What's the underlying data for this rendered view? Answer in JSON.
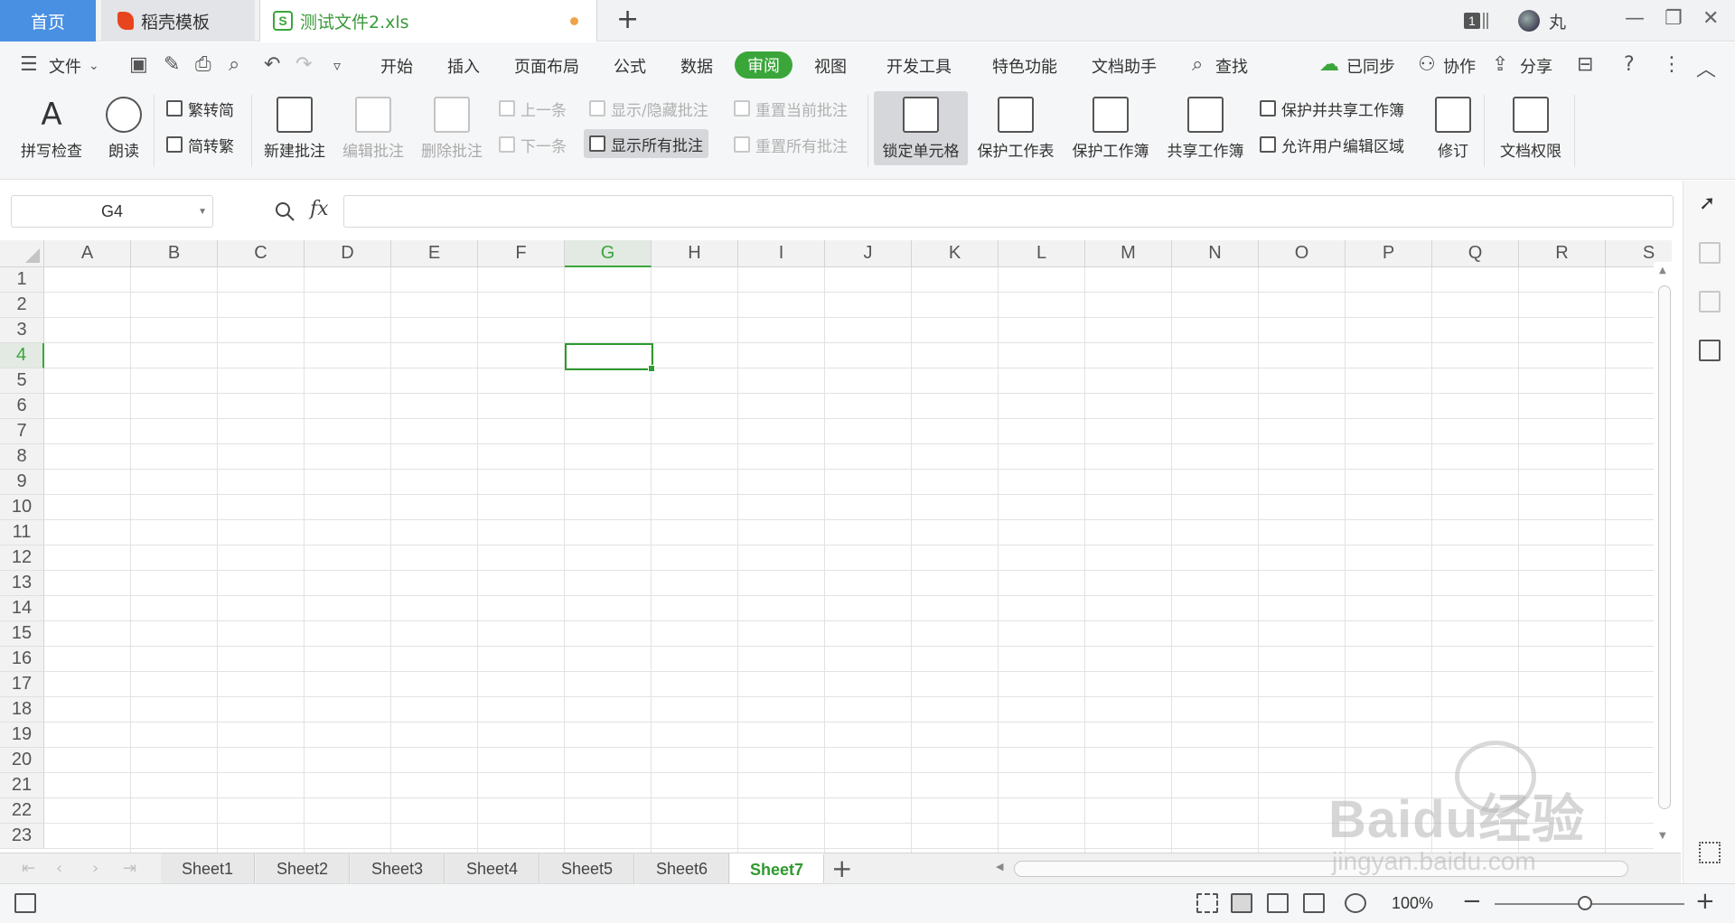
{
  "titlebar": {
    "home_tab": "首页",
    "docer_tab": "稻壳模板",
    "file_tab": "测试文件2.xls",
    "window_count": "1",
    "user_name": "丸"
  },
  "menu": {
    "file": "文件",
    "items": [
      "开始",
      "插入",
      "页面布局",
      "公式",
      "数据",
      "审阅",
      "视图",
      "开发工具",
      "特色功能",
      "文档助手"
    ],
    "active": "审阅",
    "search": "查找",
    "sync": "已同步",
    "collab": "协作",
    "share": "分享"
  },
  "ribbon": {
    "spell_check": "拼写检查",
    "read_aloud": "朗读",
    "trad_to_simp": "繁转简",
    "simp_to_trad": "简转繁",
    "new_comment": "新建批注",
    "edit_comment": "编辑批注",
    "delete_comment": "删除批注",
    "prev_comment": "上一条",
    "next_comment": "下一条",
    "show_hide_comment": "显示/隐藏批注",
    "show_all_comments": "显示所有批注",
    "reset_current_comment": "重置当前批注",
    "reset_all_comments": "重置所有批注",
    "lock_cell": "锁定单元格",
    "protect_sheet": "保护工作表",
    "protect_workbook": "保护工作簿",
    "share_workbook": "共享工作簿",
    "protect_and_share": "保护并共享工作簿",
    "allow_edit_ranges": "允许用户编辑区域",
    "track_changes": "修订",
    "doc_permissions": "文档权限"
  },
  "formula_bar": {
    "name_box": "G4",
    "fx": "fx",
    "value": ""
  },
  "grid": {
    "columns": [
      "A",
      "B",
      "C",
      "D",
      "E",
      "F",
      "G",
      "H",
      "I",
      "J",
      "K",
      "L",
      "M",
      "N",
      "O",
      "P",
      "Q",
      "R",
      "S"
    ],
    "rows": [
      "1",
      "2",
      "3",
      "4",
      "5",
      "6",
      "7",
      "8",
      "9",
      "10",
      "11",
      "12",
      "13",
      "14",
      "15",
      "16",
      "17",
      "18",
      "19",
      "20",
      "21",
      "22",
      "23"
    ],
    "selected_column": "G",
    "selected_row": "4"
  },
  "sheets": {
    "tabs": [
      "Sheet1",
      "Sheet2",
      "Sheet3",
      "Sheet4",
      "Sheet5",
      "Sheet6",
      "Sheet7"
    ],
    "active": "Sheet7"
  },
  "status": {
    "zoom": "100%"
  },
  "watermark": {
    "brand": "Baidu经验",
    "url": "jingyan.baidu.com"
  },
  "colors": {
    "accent_green": "#3aa63a",
    "home_tab_blue": "#4a90e2"
  }
}
